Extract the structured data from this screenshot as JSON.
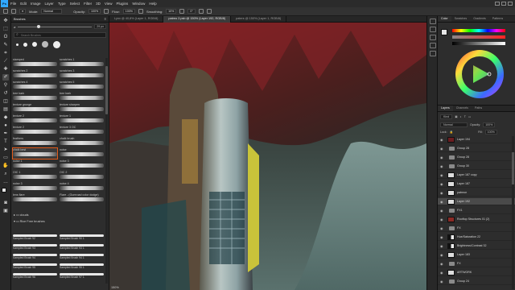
{
  "app": {
    "logo": "Ps"
  },
  "menu": [
    "File",
    "Edit",
    "Image",
    "Layer",
    "Type",
    "Select",
    "Filter",
    "3D",
    "View",
    "Plugins",
    "Window",
    "Help"
  ],
  "options": {
    "mode_label": "Mode:",
    "mode_value": "Normal",
    "opacity_label": "Opacity:",
    "opacity_value": "100%",
    "flow_label": "Flow:",
    "flow_value": "100%",
    "smoothing_label": "Smoothing:",
    "smoothing_value": "10%",
    "angle_value": "0°"
  },
  "brushes_panel": {
    "title": "Brushes",
    "size_value": "29 px",
    "search_placeholder": "Search Brushes",
    "brushes": [
      {
        "name": "stamped"
      },
      {
        "name": "scratches 1"
      },
      {
        "name": "scratches 2"
      },
      {
        "name": "scratches 3"
      },
      {
        "name": "scratches 4"
      },
      {
        "name": "scratches 5"
      },
      {
        "name": "tree bark"
      },
      {
        "name": "tree bark"
      },
      {
        "name": "texture grunge"
      },
      {
        "name": "texture sharpen"
      },
      {
        "name": "texture 2"
      },
      {
        "name": "texture 1"
      },
      {
        "name": "texture 2"
      },
      {
        "name": "texture 3 OC"
      },
      {
        "name": "feathers"
      },
      {
        "name": "chalk brush"
      },
      {
        "name": "chalk best"
      },
      {
        "name": "noise"
      },
      {
        "name": "noise 1"
      },
      {
        "name": "noise 3"
      },
      {
        "name": "OIC 1"
      },
      {
        "name": "OIC 2"
      },
      {
        "name": "noise 3"
      },
      {
        "name": "noise 4"
      },
      {
        "name": "lens flare"
      },
      {
        "name": "Flare - (Gumroad color dodge)"
      }
    ],
    "folders": [
      "clouds",
      "Rice Free brushes"
    ],
    "sampled": [
      "Sampled Brush 92",
      "Sampled Brush 90 1",
      "Sampled Brush 93",
      "Sampled Brush 93 1",
      "Sampled Brush 94",
      "Sampled Brush 94 1",
      "Sampled Brush 95",
      "Sampled Brush 95 1",
      "Sampled Brush 96",
      "Sampled Brush 97 1"
    ]
  },
  "doc_tabs": [
    {
      "label": "Lynx @ 40,8% (Layer 1, RGB/8)",
      "active": false
    },
    {
      "label": "patreo 2.psb @ 150% (Layer 192, RGB/8)",
      "active": true
    },
    {
      "label": "paters @ 150% (Layer 1, RGB/8)",
      "active": false
    }
  ],
  "status": {
    "zoom": "150%"
  },
  "color_panel": {
    "tabs": [
      "Color",
      "Swatches",
      "Gradients",
      "Patterns"
    ],
    "hue_value": "H",
    "fg": "#e6e6e6"
  },
  "layers_panel": {
    "tabs": [
      "Layers",
      "Channels",
      "Paths"
    ],
    "kind_label": "Kind",
    "blend_mode": "Normal",
    "opacity_label": "Opacity:",
    "opacity_value": "100%",
    "lock_label": "Lock:",
    "fill_label": "Fill:",
    "fill_value": "100%",
    "layers": [
      {
        "name": "Layer 194",
        "kind": "thumb",
        "selected": false
      },
      {
        "name": "Group 28",
        "kind": "folder",
        "selected": false
      },
      {
        "name": "Group 28",
        "kind": "folder",
        "selected": false
      },
      {
        "name": "Group 30",
        "kind": "folder",
        "selected": false
      },
      {
        "name": "Layer 187 copy",
        "kind": "thumb",
        "selected": false
      },
      {
        "name": "Layer 187",
        "kind": "thumb",
        "selected": false
      },
      {
        "name": "patreon",
        "kind": "thumb",
        "selected": false
      },
      {
        "name": "Layer 192",
        "kind": "thumb",
        "selected": true
      },
      {
        "name": "FX1",
        "kind": "folder",
        "selected": false
      },
      {
        "name": "Rooftop Structures 01 (2)",
        "kind": "thumb",
        "selected": false
      },
      {
        "name": "FX",
        "kind": "folder",
        "selected": false
      },
      {
        "name": "Hue/Saturation 22",
        "kind": "adj",
        "selected": false
      },
      {
        "name": "Brightness/Contrast 32",
        "kind": "adj",
        "selected": false
      },
      {
        "name": "Layer 183",
        "kind": "thumb",
        "selected": false
      },
      {
        "name": "FX",
        "kind": "folder",
        "selected": false
      },
      {
        "name": "ARTWORK",
        "kind": "thumb",
        "selected": false
      },
      {
        "name": "Group 24",
        "kind": "folder",
        "selected": false
      }
    ]
  }
}
